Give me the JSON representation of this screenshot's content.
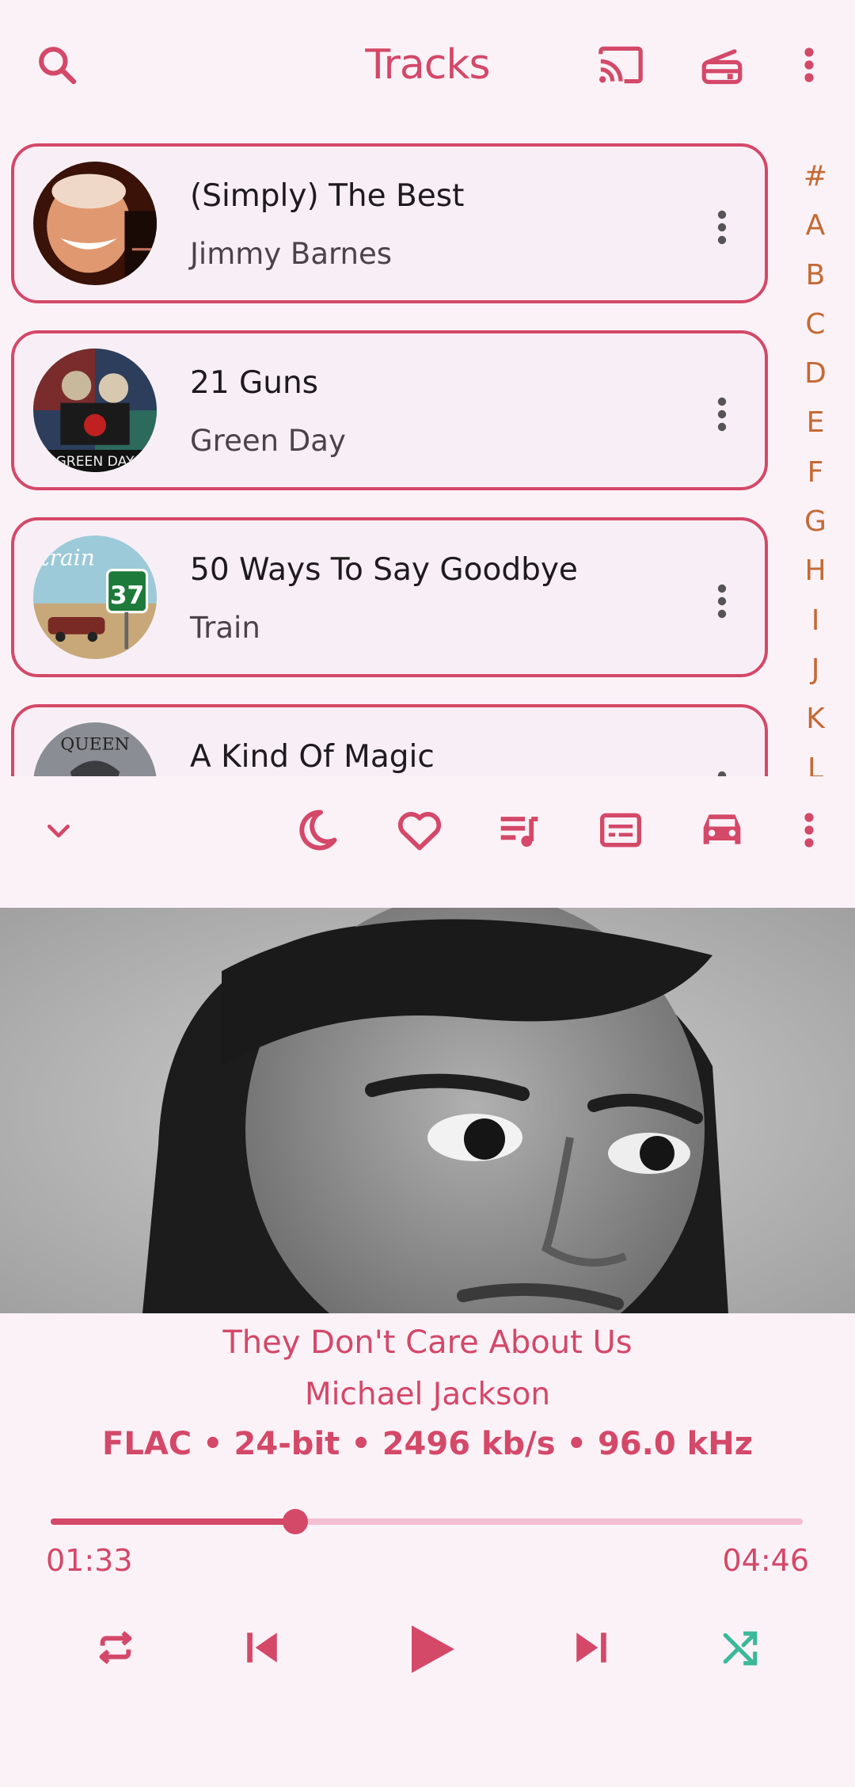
{
  "header": {
    "title": "Tracks",
    "icons": [
      "search-icon",
      "cast-icon",
      "radio-icon",
      "more-vert-icon"
    ]
  },
  "tracks": [
    {
      "title": "(Simply) The Best",
      "artist": "Jimmy Barnes"
    },
    {
      "title": "21 Guns",
      "artist": "Green Day"
    },
    {
      "title": "50 Ways To Say Goodbye",
      "artist": "Train"
    },
    {
      "title": "A Kind Of Magic",
      "artist": ""
    }
  ],
  "alphabet": [
    "#",
    "A",
    "B",
    "C",
    "D",
    "E",
    "F",
    "G",
    "H",
    "I",
    "J",
    "K",
    "L"
  ],
  "player_toolbar": {
    "icons": [
      "chevron-down-icon",
      "sleep-timer-moon-icon",
      "favorite-heart-icon",
      "queue-music-icon",
      "lyrics-icon",
      "car-mode-icon",
      "more-vert-icon"
    ]
  },
  "now_playing": {
    "title": "They Don't Care About Us",
    "artist": "Michael Jackson",
    "meta": "FLAC • 24-bit • 2496 kb/s • 96.0 kHz",
    "elapsed": "01:33",
    "duration": "04:46",
    "progress_fraction": 0.325
  },
  "controls": [
    "repeat-icon",
    "skip-previous-icon",
    "play-icon",
    "skip-next-icon",
    "shuffle-icon"
  ],
  "colors": {
    "accent": "#d44868",
    "background": "#fbf2f8",
    "alphabet": "#c46a35",
    "shuffle": "#3bb89a",
    "progress_track": "#f2bfd0"
  }
}
